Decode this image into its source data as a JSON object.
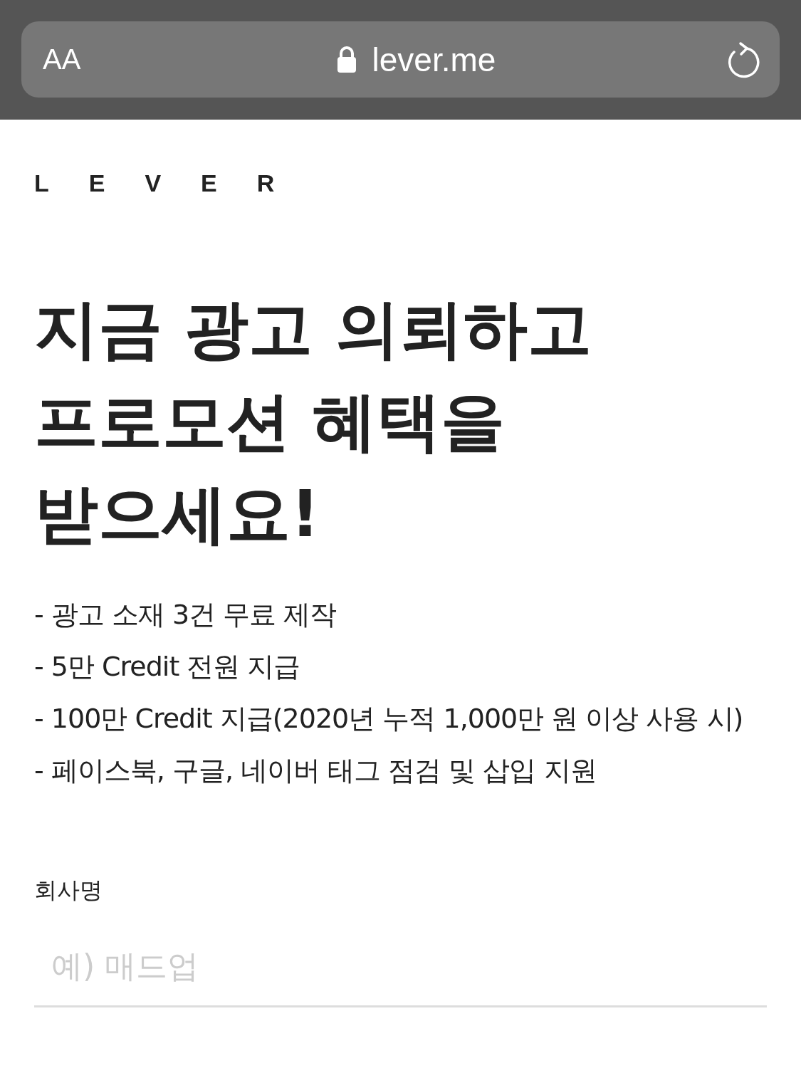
{
  "browser": {
    "text_size_button": "AA",
    "url": "lever.me"
  },
  "logo": "LEVER",
  "headline": "지금 광고 의뢰하고\n프로모션 혜택을\n받으세요!",
  "benefits": [
    "- 광고 소재 3건 무료 제작",
    "- 5만 Credit 전원 지급",
    "- 100만 Credit 지급(2020년 누적 1,000만 원 이상 사용 시)",
    "- 페이스북, 구글, 네이버 태그 점검 및 삽입 지원"
  ],
  "form": {
    "label": "회사명",
    "placeholder": "예) 매드업"
  }
}
